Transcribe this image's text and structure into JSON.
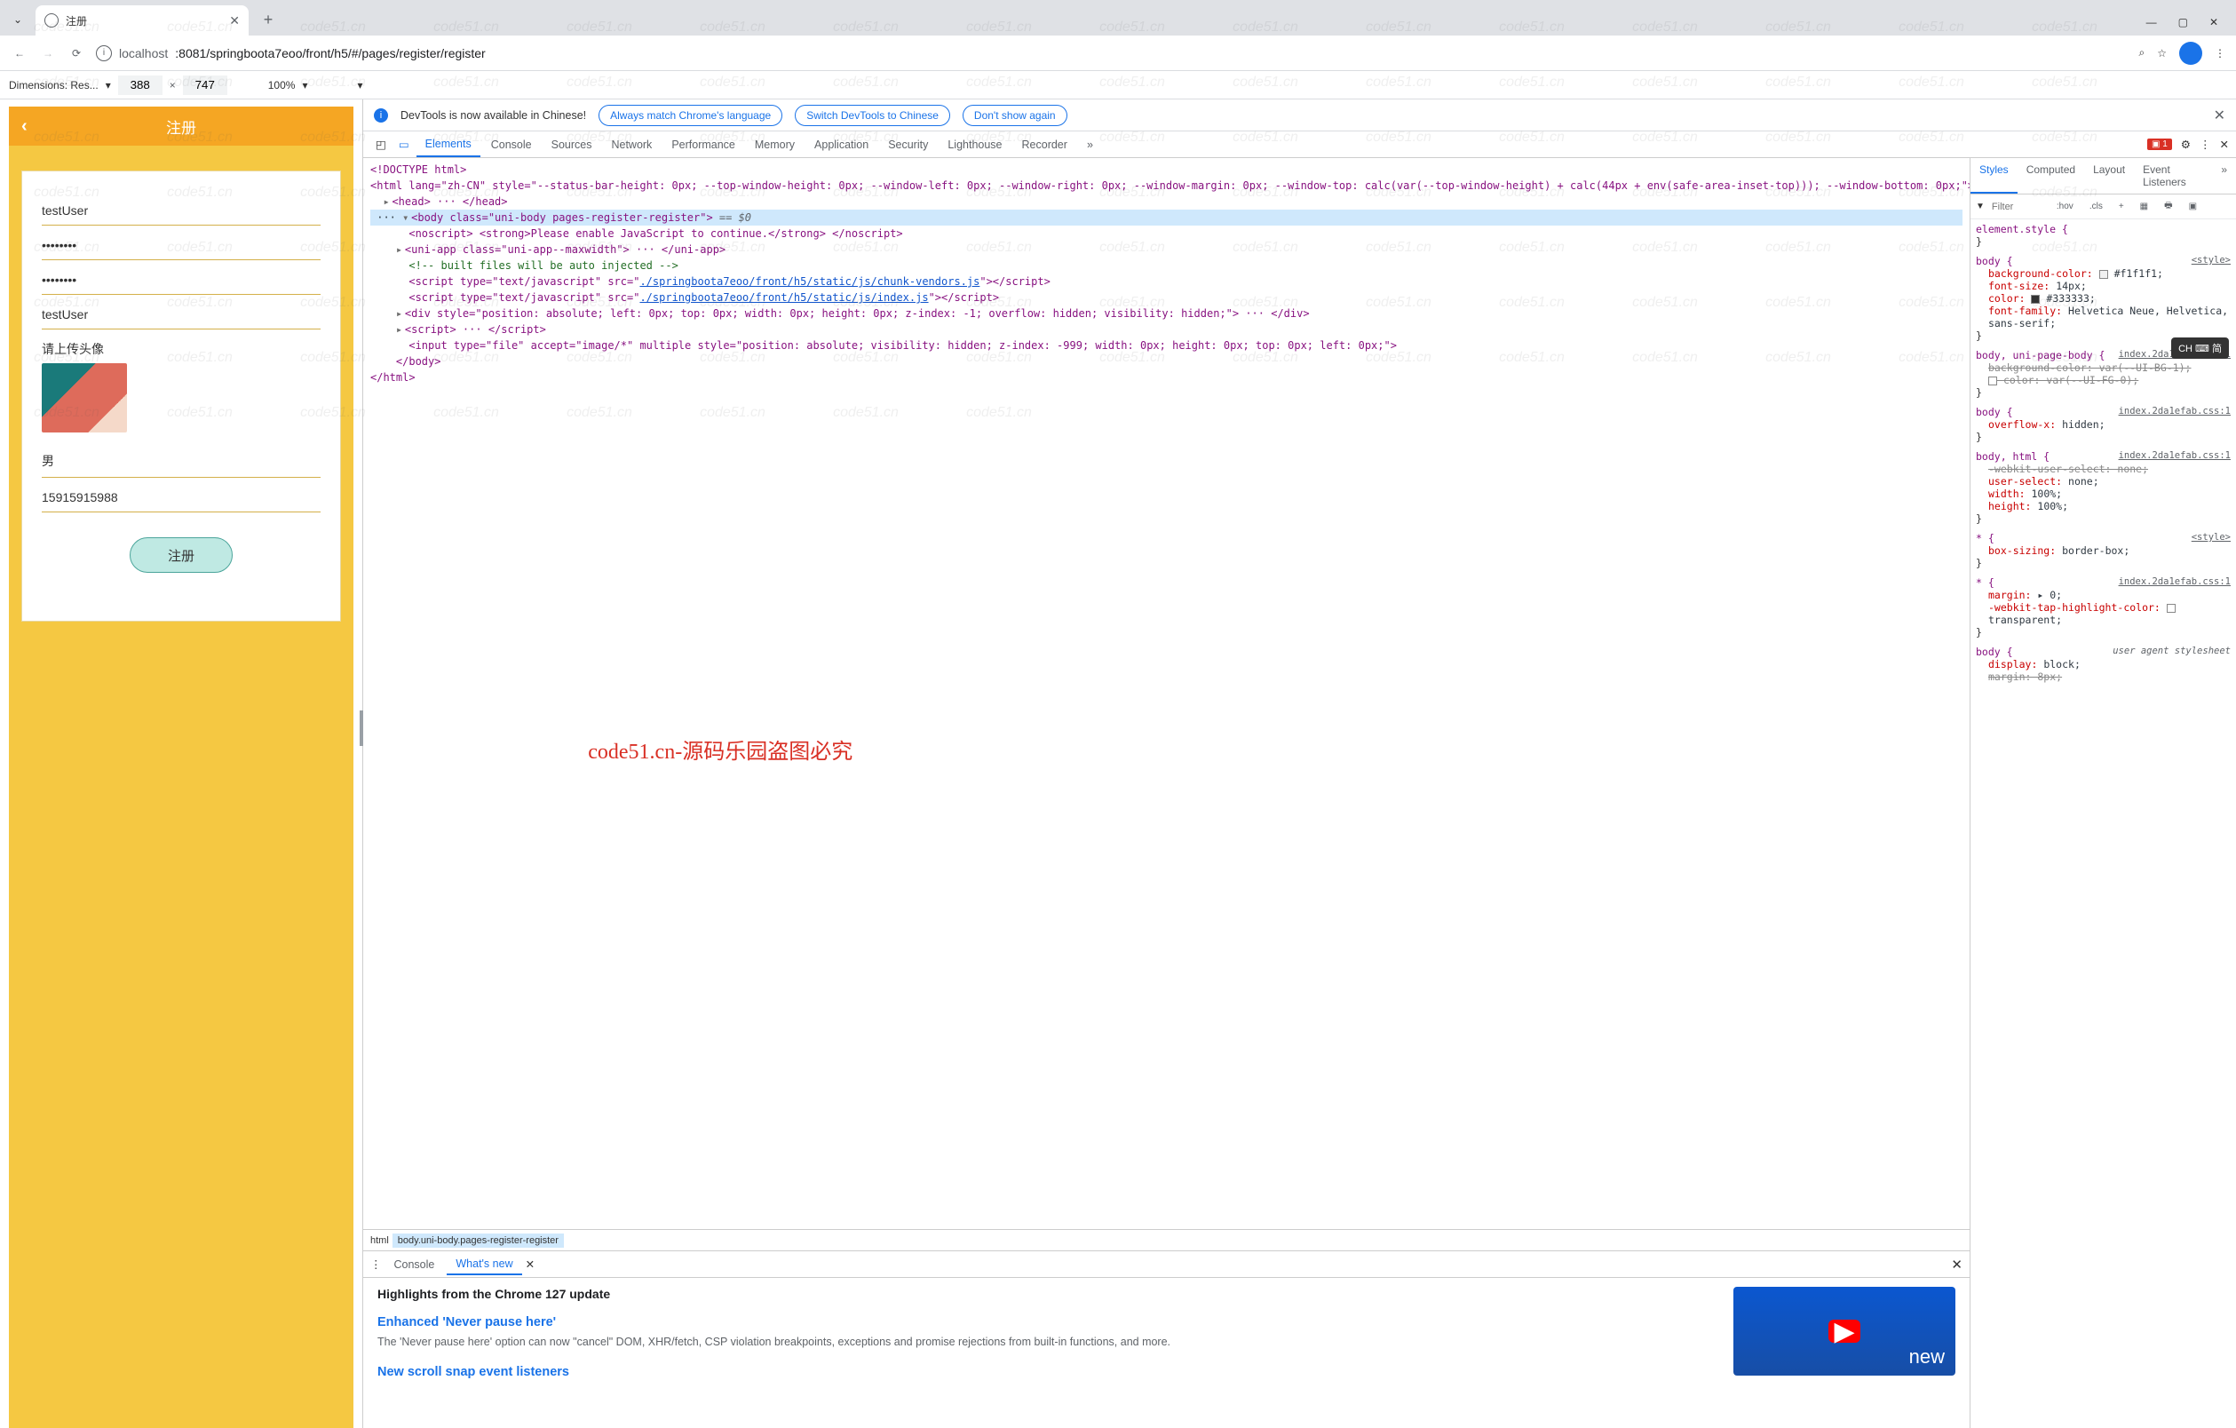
{
  "browser": {
    "tab_title": "注册",
    "url_host": "localhost",
    "url_port_path": ":8081/springboota7eoo/front/h5/#/pages/register/register"
  },
  "device_bar": {
    "dimensions_label": "Dimensions: Res...",
    "width": "388",
    "height": "747",
    "zoom": "100%"
  },
  "infobar": {
    "message": "DevTools is now available in Chinese!",
    "btn1": "Always match Chrome's language",
    "btn2": "Switch DevTools to Chinese",
    "btn3": "Don't show again"
  },
  "dt_tabs": [
    "Elements",
    "Console",
    "Sources",
    "Network",
    "Performance",
    "Memory",
    "Application",
    "Security",
    "Lighthouse",
    "Recorder"
  ],
  "dt_tabs_more": "»",
  "issue_count": "1",
  "phone": {
    "title": "注册",
    "username": "testUser",
    "password": "••••••••",
    "password2": "••••••••",
    "nickname": "testUser",
    "avatar_label": "请上传头像",
    "gender": "男",
    "phone": "15915915988",
    "submit": "注册"
  },
  "dom": {
    "doctype": "<!DOCTYPE html>",
    "html_open": "<html lang=\"zh-CN\" style=\"--status-bar-height: 0px; --top-window-height: 0px; --window-left: 0px; --window-right: 0px; --window-margin: 0px; --window-top: calc(var(--top-window-height) + calc(44px + env(safe-area-inset-top))); --window-bottom: 0px;\">",
    "head": "<head> ··· </head>",
    "body_open": "<body class=\"uni-body pages-register-register\">",
    "body_dim": " == $0",
    "noscript": "<noscript> <strong>Please enable JavaScript to continue.</strong> </noscript>",
    "uniapp": "<uni-app class=\"uni-app--maxwidth\"> ··· </uni-app>",
    "comment": "<!-- built files will be auto injected -->",
    "script1a": "<script type=\"text/javascript\" src=\"",
    "script1b": "./springboota7eoo/front/h5/static/js/chunk-vendors.js",
    "script1c": "\"></script",
    "script2a": "<script type=\"text/javascript\" src=\"",
    "script2b": "./springboota7eoo/front/h5/static/js/index.js",
    "script2c": "\"></script",
    "div": "<div style=\"position: absolute; left: 0px; top: 0px; width: 0px; height: 0px; z-index: -1; overflow: hidden; visibility: hidden;\"> ··· </div>",
    "script3": "<script> ··· </script",
    "input": "<input type=\"file\" accept=\"image/*\" multiple style=\"position: absolute; visibility: hidden; z-index: -999; width: 0px; height: 0px; top: 0px; left: 0px;\">",
    "body_close": "</body>",
    "html_close": "</html>"
  },
  "breadcrumb": {
    "b1": "html",
    "b2": "body.uni-body.pages-register-register"
  },
  "styles_tabs": [
    "Styles",
    "Computed",
    "Layout",
    "Event Listeners"
  ],
  "filter_placeholder": "Filter",
  "rule0": {
    "sel": "element.style {",
    "end": "}"
  },
  "rule1": {
    "sel": "body {",
    "src": "<style>",
    "p1n": "background-color:",
    "p1v": "#f1f1f1;",
    "p2n": "font-size:",
    "p2v": "14px;",
    "p3n": "color:",
    "p3v": "#333333;",
    "p4n": "font-family:",
    "p4v": "Helvetica Neue, Helvetica, sans-serif;",
    "end": "}"
  },
  "rule2": {
    "sel": "body, uni-page-body {",
    "src": "index.2da1efab.css:1",
    "p1": "background-color: var(--UI-BG-1);",
    "p2": "color: var(--UI-FG-0);",
    "end": "}"
  },
  "rule3": {
    "sel": "body {",
    "src": "index.2da1efab.css:1",
    "p1n": "overflow-x:",
    "p1v": "hidden;",
    "end": "}"
  },
  "rule4": {
    "sel": "body, html {",
    "src": "index.2da1efab.css:1",
    "p1": "-webkit-user-select: none;",
    "p2n": "user-select:",
    "p2v": "none;",
    "p3n": "width:",
    "p3v": "100%;",
    "p4n": "height:",
    "p4v": "100%;",
    "end": "}"
  },
  "rule5": {
    "sel": "* {",
    "src": "<style>",
    "p1n": "box-sizing:",
    "p1v": "border-box;",
    "end": "}"
  },
  "rule6": {
    "sel": "* {",
    "src": "index.2da1efab.css:1",
    "p1n": "margin:",
    "p1v": "▸ 0;",
    "p2n": "-webkit-tap-highlight-color:",
    "p2v": "transparent;",
    "end": "}"
  },
  "rule7": {
    "sel": "body {",
    "src": "user agent stylesheet",
    "p1n": "display:",
    "p1v": "block;",
    "p2": "margin: 8px;",
    "end": ""
  },
  "drawer": {
    "tab_console": "Console",
    "tab_whatsnew": "What's new",
    "highlights": "Highlights from the Chrome 127 update",
    "h1": "Enhanced 'Never pause here'",
    "p1": "The 'Never pause here' option can now \"cancel\" DOM, XHR/fetch, CSP violation breakpoints, exceptions and promise rejections from built-in functions, and more.",
    "h2": "New scroll snap event listeners",
    "promo": "new"
  },
  "watermark_text": "code51.cn-源码乐园盗图必究",
  "watermark_bg": "code51.cn",
  "ime": "CH ⌨ 简"
}
